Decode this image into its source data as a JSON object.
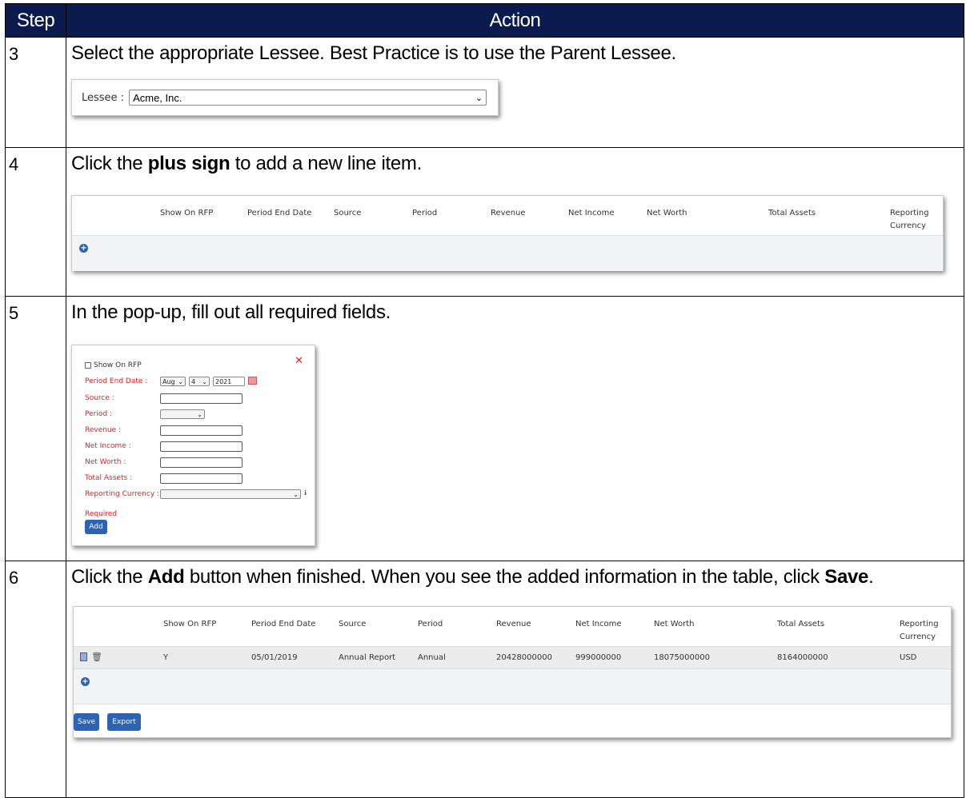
{
  "header": {
    "step": "Step",
    "action": "Action"
  },
  "steps": [
    {
      "num": "3",
      "text": "Select the appropriate Lessee. Best Practice is to use the Parent Lessee."
    },
    {
      "num": "4",
      "text_pre": "Click the ",
      "text_bold": "plus sign",
      "text_post": " to add a new line item."
    },
    {
      "num": "5",
      "text": "In the pop-up, fill out all required fields."
    },
    {
      "num": "6",
      "text_pre": "Click the ",
      "text_bold": "Add",
      "text_mid": " button when finished. When you see the added information in the table, click ",
      "text_bold2": "Save",
      "text_post": "."
    }
  ],
  "lessee": {
    "label": "Lessee :",
    "value": "Acme, Inc."
  },
  "columns": [
    "Show On RFP",
    "Period End Date",
    "Source",
    "Period",
    "Revenue",
    "Net Income",
    "Net Worth",
    "Total Assets",
    "Reporting Currency"
  ],
  "popup": {
    "show_rfp": "Show On RFP",
    "period_end_date": "Period End Date :",
    "month": "Aug",
    "day": "4",
    "year": "2021",
    "source": "Source :",
    "period": "Period :",
    "revenue": "Revenue :",
    "net_income": "Net Income :",
    "net_worth": "Net Worth :",
    "total_assets": "Total Assets :",
    "reporting_currency": "Reporting Currency :",
    "required": "Required",
    "add": "Add"
  },
  "row": {
    "show_rfp": "Y",
    "period_end_date": "05/01/2019",
    "source": "Annual Report",
    "period": "Annual",
    "revenue": "20428000000",
    "net_income": "999000000",
    "net_worth": "18075000000",
    "total_assets": "8164000000",
    "currency": "USD"
  },
  "buttons": {
    "save": "Save",
    "export": "Export"
  },
  "colors": {
    "header_bg": "#0b1b4d",
    "button_blue": "#2b63b5",
    "required_red": "#dd2222"
  }
}
